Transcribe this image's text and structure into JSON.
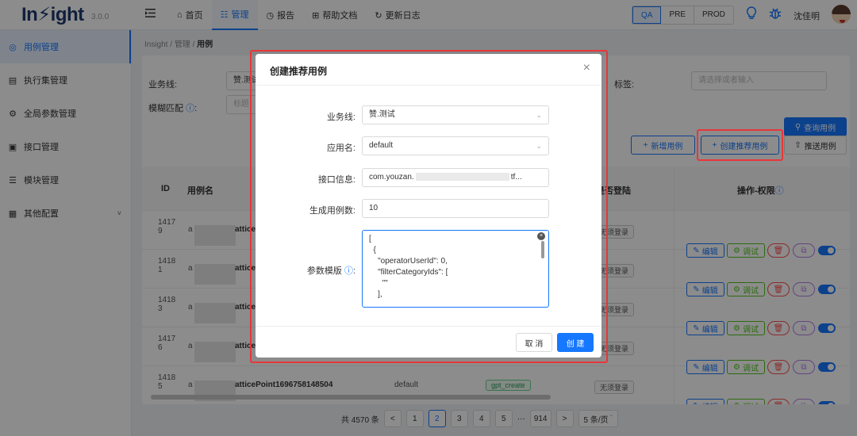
{
  "header": {
    "logo": "In⚡ight",
    "version": "3.0.0",
    "nav": [
      {
        "icon": "⌂",
        "label": "首页"
      },
      {
        "icon": "☷",
        "label": "管理"
      },
      {
        "icon": "◷",
        "label": "报告"
      },
      {
        "icon": "⊞",
        "label": "帮助文档"
      },
      {
        "icon": "↻",
        "label": "更新日志"
      }
    ],
    "envs": [
      "QA",
      "PRE",
      "PROD"
    ],
    "active_env": "QA",
    "user_name": "沈佳明"
  },
  "sidebar": {
    "items": [
      {
        "icon": "◎",
        "label": "用例管理"
      },
      {
        "icon": "▤",
        "label": "执行集管理"
      },
      {
        "icon": "⚙",
        "label": "全局参数管理"
      },
      {
        "icon": "▣",
        "label": "接口管理"
      },
      {
        "icon": "☰",
        "label": "模块管理"
      },
      {
        "icon": "▦",
        "label": "其他配置",
        "expand": "˅"
      }
    ]
  },
  "breadcrumb": {
    "root": "Insight",
    "section": "管理",
    "current": "用例"
  },
  "filters": {
    "business_label": "业务线:",
    "business_value": "赞.测试",
    "fuzzy_label": "模糊匹配",
    "fuzzy_placeholder": "标题",
    "tag_label": "标签:",
    "tag_placeholder": "请选择或者输入",
    "query_button": "查询用例",
    "add_button": "新增用例",
    "create_recommend_button": "创建推荐用例",
    "push_button": "推送用例"
  },
  "table": {
    "headers": {
      "id": "ID",
      "name": "用例名",
      "login": "是否登陆",
      "actions": "操作-权限"
    },
    "rows": [
      {
        "id_top": "1417",
        "id_bottom": "9",
        "name_prefix": "a",
        "name_suffix": "atticeP",
        "app": "",
        "tag": "",
        "login": "无须登录"
      },
      {
        "id_top": "1418",
        "id_bottom": "1",
        "name_prefix": "a",
        "name_suffix": "atticeP",
        "app": "",
        "tag": "",
        "login": "无须登录"
      },
      {
        "id_top": "1418",
        "id_bottom": "3",
        "name_prefix": "a",
        "name_suffix": "atticeP",
        "app": "",
        "tag": "",
        "login": "无须登录"
      },
      {
        "id_top": "1417",
        "id_bottom": "6",
        "name_prefix": "a",
        "name_suffix": "atticeP",
        "app": "",
        "tag": "",
        "login": "无须登录"
      },
      {
        "id_top": "1418",
        "id_bottom": "5",
        "name_prefix": "a",
        "name_suffix": "atticePoint1696758148504",
        "app": "default",
        "tag": "gpt_create",
        "login": "无须登录"
      }
    ],
    "action_edit": "编辑",
    "action_debug": "调试"
  },
  "pagination": {
    "total": "共 4570 条",
    "prev": "<",
    "pages": [
      "1",
      "2",
      "3",
      "4",
      "5"
    ],
    "active_page": "2",
    "ellipsis": "···",
    "last_page": "914",
    "next": ">",
    "page_size": "5 条/页"
  },
  "modal": {
    "title": "创建推荐用例",
    "close": "×",
    "business_label": "业务线:",
    "business_value": "赞.测试",
    "app_label": "应用名:",
    "app_value": "default",
    "interface_label": "接口信息:",
    "interface_value": "com.youzan.",
    "interface_suffix": "tf...",
    "count_label": "生成用例数:",
    "count_value": "10",
    "params_label": "参数模版",
    "params_value": "[\n  {\n    \"operatorUserId\": 0,\n    \"filterCategoryIds\": [\n      \"\"\n    ],",
    "cancel": "取 消",
    "create": "创 建"
  }
}
